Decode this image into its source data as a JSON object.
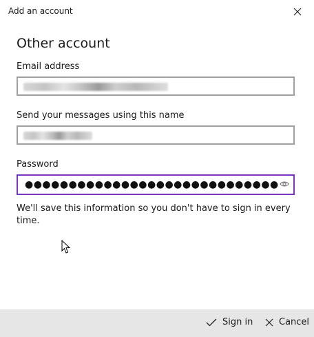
{
  "window": {
    "title": "Add an account"
  },
  "form": {
    "heading": "Other account",
    "email_label": "Email address",
    "name_label": "Send your messages using this name",
    "password_label": "Password",
    "password_value": "●●●●●●●●●●●●●●●●●●●●●●●●●●●●●",
    "info_text": "We'll save this information so you don't have to sign in every time."
  },
  "footer": {
    "sign_in_label": "Sign in",
    "cancel_label": "Cancel"
  },
  "icons": {
    "close": "close-icon",
    "reveal_password": "eye-icon",
    "sign_in": "checkmark-icon",
    "cancel": "cancel-x-icon",
    "cursor": "mouse-pointer-icon"
  },
  "colors": {
    "focus_border": "#7a35c6",
    "field_border": "#a0a0a0",
    "footer_bg": "#e6e6e6"
  }
}
